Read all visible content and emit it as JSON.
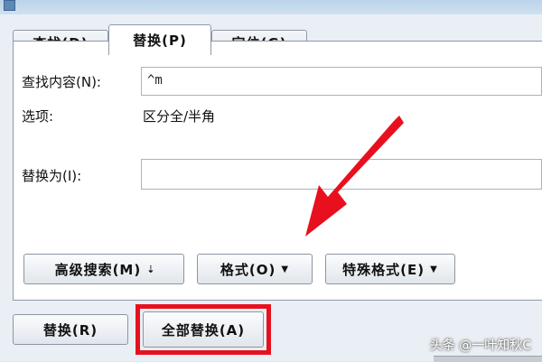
{
  "tabs": [
    {
      "label": "查找(D)",
      "active": false
    },
    {
      "label": "替换(P)",
      "active": true
    },
    {
      "label": "定位(G)",
      "active": false
    }
  ],
  "find": {
    "label": "查找内容(N):",
    "value": "^m"
  },
  "options": {
    "label": "选项:",
    "value": "区分全/半角"
  },
  "replace": {
    "label": "替换为(I):",
    "value": ""
  },
  "panel_buttons": {
    "advanced": "高级搜索(M)",
    "advanced_arrow": "⇣",
    "format": "格式(O)",
    "special": "特殊格式(E)"
  },
  "action_buttons": {
    "replace": "替换(R)",
    "replace_all": "全部替换(A)"
  },
  "watermark": "头条 @一叶知秋C",
  "colors": {
    "highlight": "#e8101e",
    "arrow": "#e8101e"
  }
}
